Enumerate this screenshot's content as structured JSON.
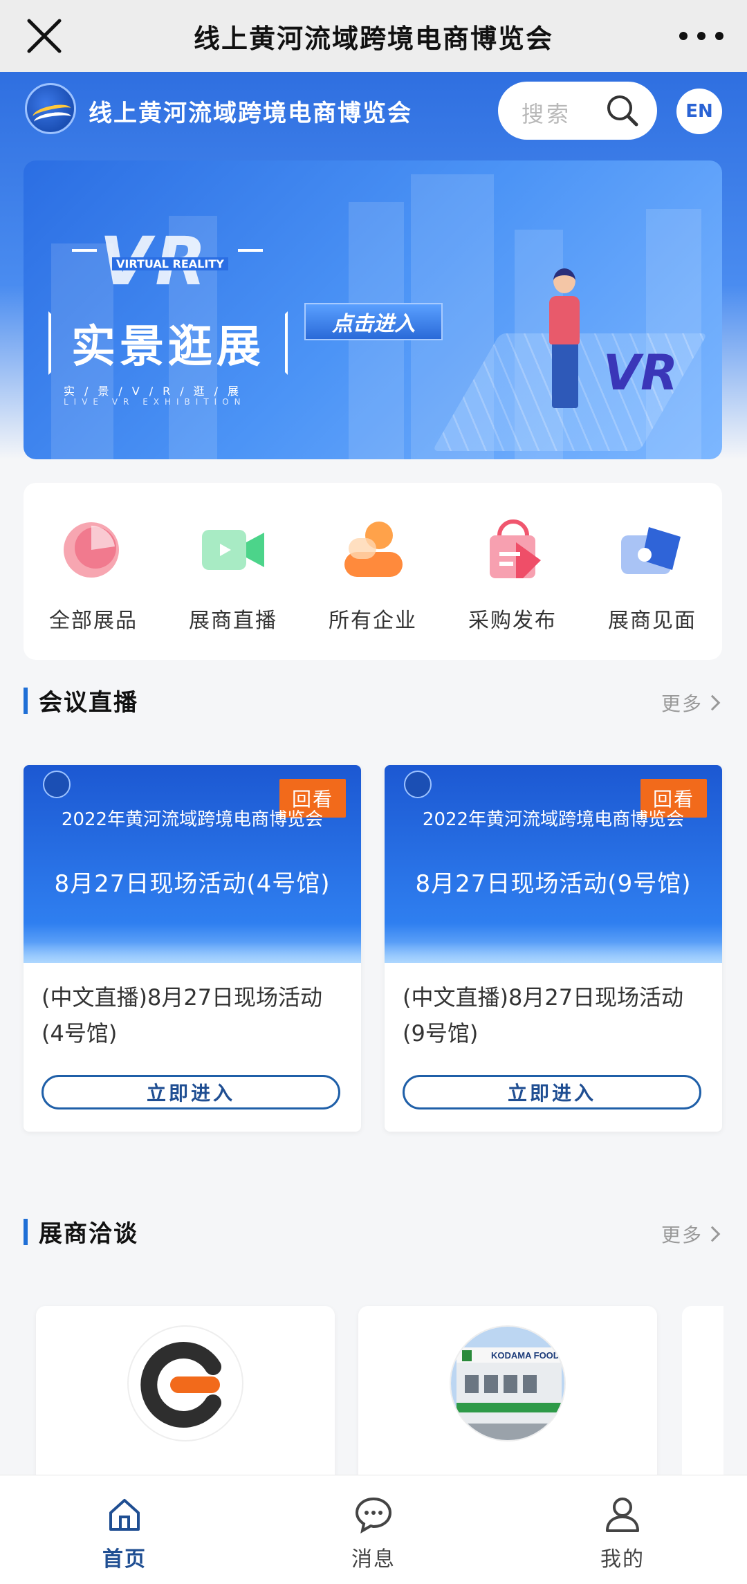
{
  "topbar": {
    "title": "线上黄河流域跨境电商博览会"
  },
  "header": {
    "site_name": "线上黄河流域跨境电商博览会",
    "search_placeholder": "搜索",
    "lang": "EN"
  },
  "banner": {
    "vr": "VR",
    "vr_sub": "VIRTUAL REALITY",
    "title": "实景逛展",
    "line1": "实/景/V/R/逛/展",
    "line2": "LIVE VR EXHIBITION",
    "enter": "点击进入",
    "vr_badge": "VR"
  },
  "quicknav": [
    {
      "label": "全部展品",
      "icon": "all-products-icon"
    },
    {
      "label": "展商直播",
      "icon": "live-video-icon"
    },
    {
      "label": "所有企业",
      "icon": "enterprises-icon"
    },
    {
      "label": "采购发布",
      "icon": "purchase-icon"
    },
    {
      "label": "展商见面",
      "icon": "meeting-icon"
    }
  ],
  "meeting_live": {
    "title": "会议直播",
    "more": "更多",
    "cards": [
      {
        "badge": "回看",
        "expo": "2022年黄河流域跨境电商博览会",
        "big": "8月27日现场活动(4号馆)",
        "desc": "(中文直播)8月27日现场活动(4号馆)",
        "enter": "立即进入"
      },
      {
        "badge": "回看",
        "expo": "2022年黄河流域跨境电商博览会",
        "big": "8月27日现场活动(9号馆)",
        "desc": "(中文直播)8月27日现场活动(9号馆)",
        "enter": "立即进入"
      }
    ]
  },
  "exhibitor_talks": {
    "title": "展商洽谈",
    "more": "更多",
    "cards": [
      {
        "name": "e"
      },
      {
        "name": "KODAMA FOODS CO.,LTD."
      }
    ]
  },
  "tabbar": [
    {
      "label": "首页",
      "icon": "home-icon",
      "active": true
    },
    {
      "label": "消息",
      "icon": "message-icon",
      "active": false
    },
    {
      "label": "我的",
      "icon": "profile-icon",
      "active": false
    }
  ],
  "colors": {
    "brand_blue": "#2f6fe0",
    "accent_orange": "#f26a1b",
    "tab_active": "#1f4e92"
  }
}
